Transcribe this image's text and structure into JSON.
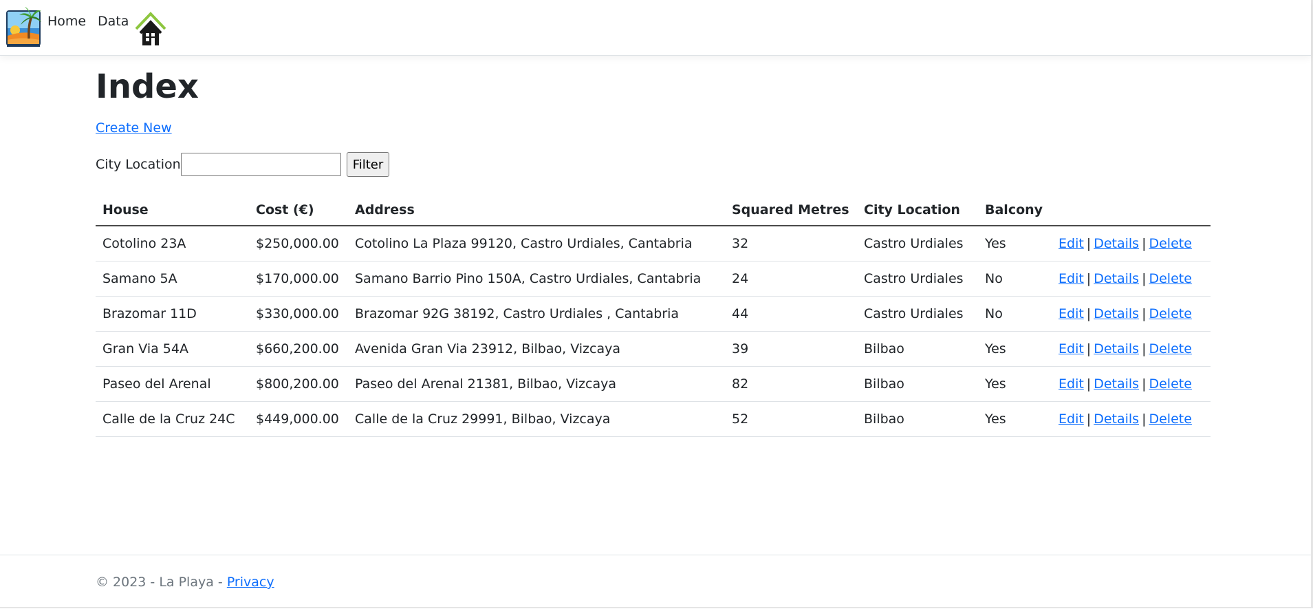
{
  "nav": {
    "brand_icon": "beach-palm-logo",
    "links": [
      "Home",
      "Data"
    ],
    "house_icon": "house-icon"
  },
  "main": {
    "title": "Index",
    "create_link": "Create New",
    "filter": {
      "label": "City Location:",
      "value": "",
      "button": "Filter"
    },
    "table": {
      "headers": [
        "House",
        "Cost (€)",
        "Address",
        "Squared Metres",
        "City Location",
        "Balcony",
        ""
      ],
      "action_labels": [
        "Edit",
        "Details",
        "Delete"
      ],
      "separator": "|",
      "rows": [
        [
          "Cotolino 23A",
          "$250,000.00",
          "Cotolino La Plaza 99120, Castro Urdiales, Cantabria",
          "32",
          "Castro Urdiales",
          "Yes"
        ],
        [
          "Samano 5A",
          "$170,000.00",
          "Samano Barrio Pino 150A, Castro Urdiales, Cantabria",
          "24",
          "Castro Urdiales",
          "No"
        ],
        [
          "Brazomar 11D",
          "$330,000.00",
          "Brazomar 92G 38192, Castro Urdiales , Cantabria",
          "44",
          "Castro Urdiales",
          "No"
        ],
        [
          "Gran Via 54A",
          "$660,200.00",
          "Avenida Gran Via 23912, Bilbao, Vizcaya",
          "39",
          "Bilbao",
          "Yes"
        ],
        [
          "Paseo del Arenal",
          "$800,200.00",
          "Paseo del Arenal 21381, Bilbao, Vizcaya",
          "82",
          "Bilbao",
          "Yes"
        ],
        [
          "Calle de la Cruz 24C",
          "$449,000.00",
          "Calle de la Cruz 29991, Bilbao, Vizcaya",
          "52",
          "Bilbao",
          "Yes"
        ]
      ]
    }
  },
  "footer": {
    "text": "© 2023 - La Playa - ",
    "privacy_link": "Privacy"
  },
  "colors": {
    "link": "#0d6efd",
    "text": "#212529",
    "muted": "#6c757d"
  }
}
